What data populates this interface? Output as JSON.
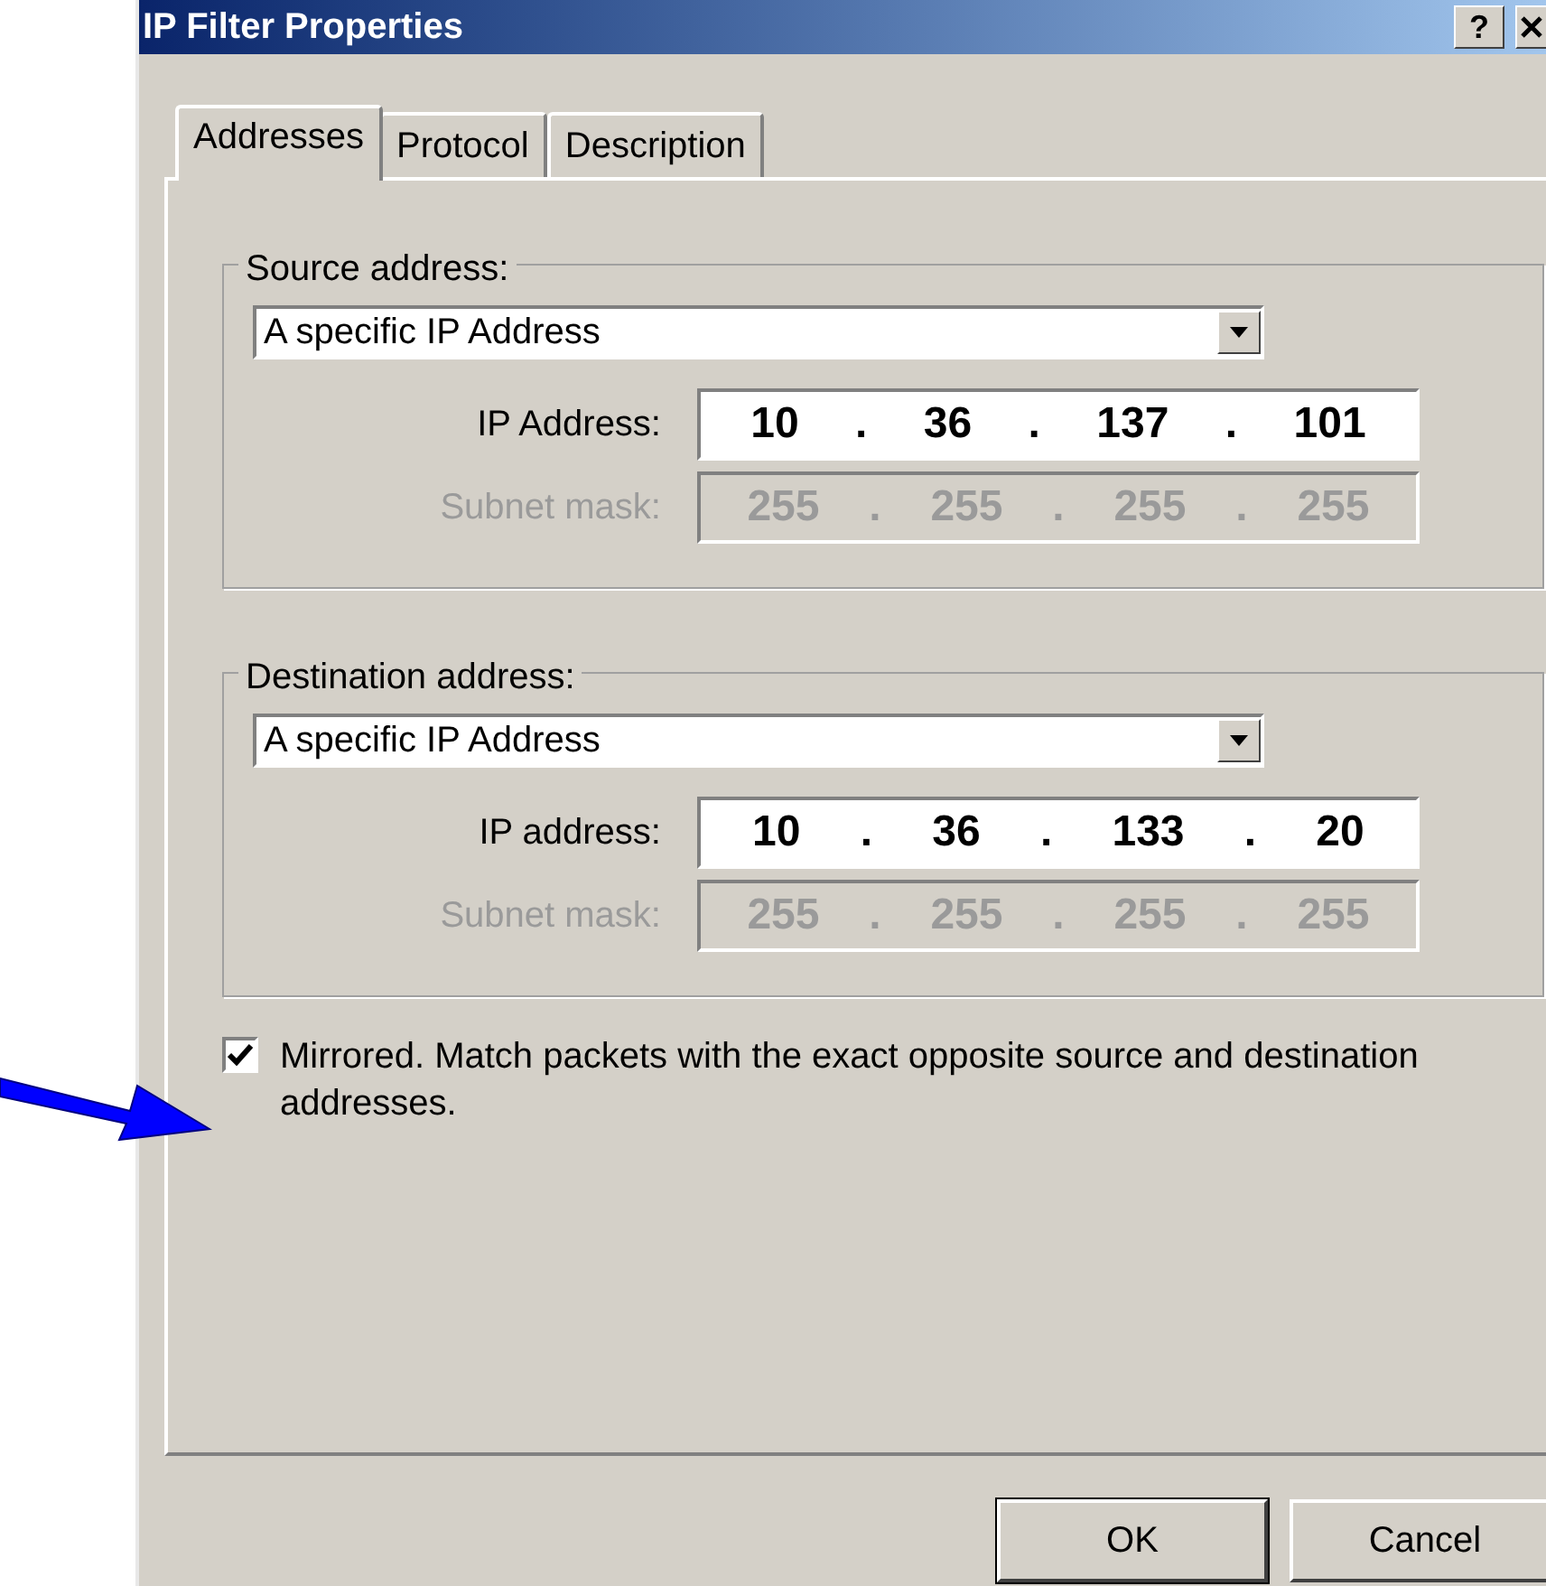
{
  "window": {
    "title": "IP Filter Properties",
    "help_button": "?"
  },
  "tabs": [
    {
      "label": "Addresses",
      "selected": true
    },
    {
      "label": "Protocol",
      "selected": false
    },
    {
      "label": "Description",
      "selected": false
    }
  ],
  "groups": [
    {
      "label": "Source address:",
      "dropdown": "A specific IP Address",
      "ip_label": "IP Address:",
      "ip": [
        "10",
        ".",
        "36",
        ".",
        "137",
        ".",
        "101"
      ],
      "mask_label": "Subnet mask:",
      "mask": [
        "255",
        ".",
        "255",
        ".",
        "255",
        ".",
        "255"
      ],
      "mask_disabled": true
    },
    {
      "label": "Destination address:",
      "dropdown": "A specific IP Address",
      "ip_label": "IP address:",
      "ip": [
        "10",
        ".",
        "36",
        ".",
        "133",
        ".",
        "20"
      ],
      "mask_label": "Subnet mask:",
      "mask": [
        "255",
        ".",
        "255",
        ".",
        "255",
        ".",
        "255"
      ],
      "mask_disabled": true
    }
  ],
  "mirrored": {
    "label": "Mirrored. Match packets with the exact opposite source and destination addresses.",
    "checked": true
  },
  "buttons": [
    {
      "label": "OK",
      "default": true
    },
    {
      "label": "Cancel",
      "default": false
    }
  ]
}
